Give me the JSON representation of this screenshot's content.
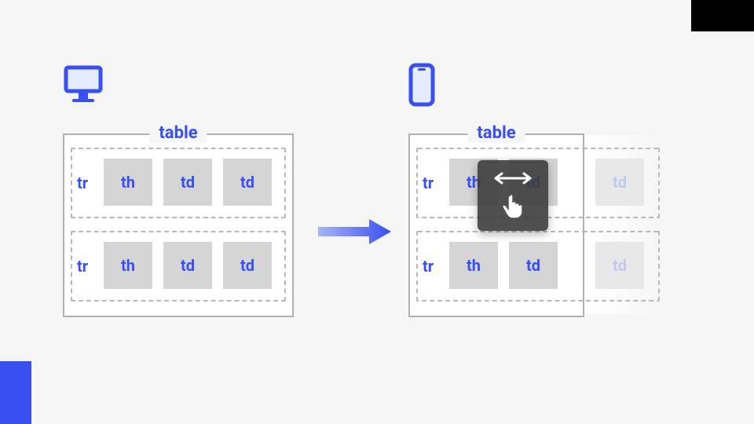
{
  "table_label": "table",
  "desktop": {
    "rows": [
      {
        "label": "tr",
        "cells": [
          "th",
          "td",
          "td"
        ]
      },
      {
        "label": "tr",
        "cells": [
          "th",
          "td",
          "td"
        ]
      }
    ]
  },
  "mobile": {
    "rows": [
      {
        "label": "tr",
        "cells": [
          "th",
          "td"
        ],
        "overflow": "td"
      },
      {
        "label": "tr",
        "cells": [
          "th",
          "td"
        ],
        "overflow": "td"
      }
    ]
  },
  "icons": {
    "desktop": "desktop-monitor",
    "mobile": "smartphone",
    "arrow": "right-arrow",
    "swipe": "swipe-horizontal"
  }
}
